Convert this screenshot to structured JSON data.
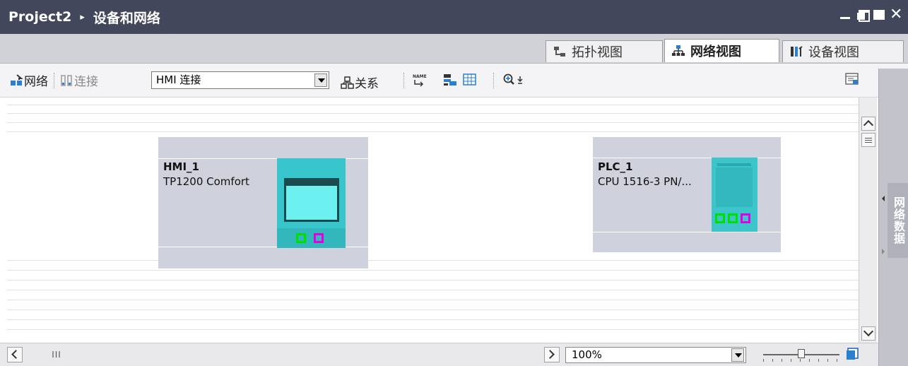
{
  "titlebar": {
    "project": "Project2",
    "separator": "▸",
    "section": "设备和网络"
  },
  "view_tabs": [
    {
      "label": "拓扑视图",
      "icon": "topology-icon",
      "active": false
    },
    {
      "label": "网络视图",
      "icon": "network-icon",
      "active": true
    },
    {
      "label": "设备视图",
      "icon": "device-icon",
      "active": false
    }
  ],
  "toolbar": {
    "network_label": "网络",
    "connect_label": "连接",
    "connection_type": "HMI 连接",
    "relations_label": "关系",
    "name_icon_text": "NAME"
  },
  "canvas": {
    "devices": [
      {
        "name": "HMI_1",
        "type": "TP1200 Comfort"
      },
      {
        "name": "PLC_1",
        "type": "CPU 1516-3 PN/..."
      }
    ]
  },
  "sidebar": {
    "tab_label": "网络数据"
  },
  "bottombar": {
    "scroll_thumb": "III",
    "zoom_value": "100%",
    "zoom_slider_level": 0.5
  },
  "colors": {
    "titlebar_bg": "#42475b",
    "device_accent": "#39c5cc",
    "port_green": "#00e000",
    "port_magenta": "#e000e0"
  }
}
